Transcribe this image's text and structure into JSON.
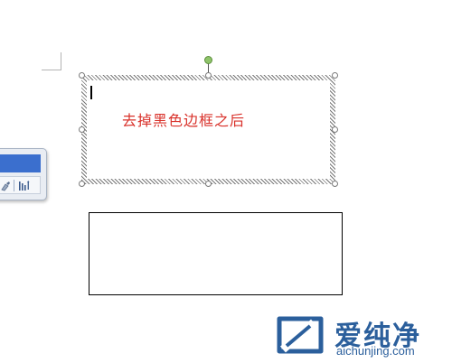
{
  "document": {
    "textbox_selected": {
      "text": "去掉黑色边框之后"
    }
  },
  "mini_toolbar": {
    "icons": [
      "brush-icon",
      "sort-icon"
    ]
  },
  "watermark": {
    "brand": "爱纯净",
    "url": "aichunjing.com"
  },
  "colors": {
    "text_red": "#d9322b",
    "brand_blue": "#2b5f9c",
    "toolbar_blue": "#3b6fce",
    "rotation_handle": "#8fc46a"
  }
}
